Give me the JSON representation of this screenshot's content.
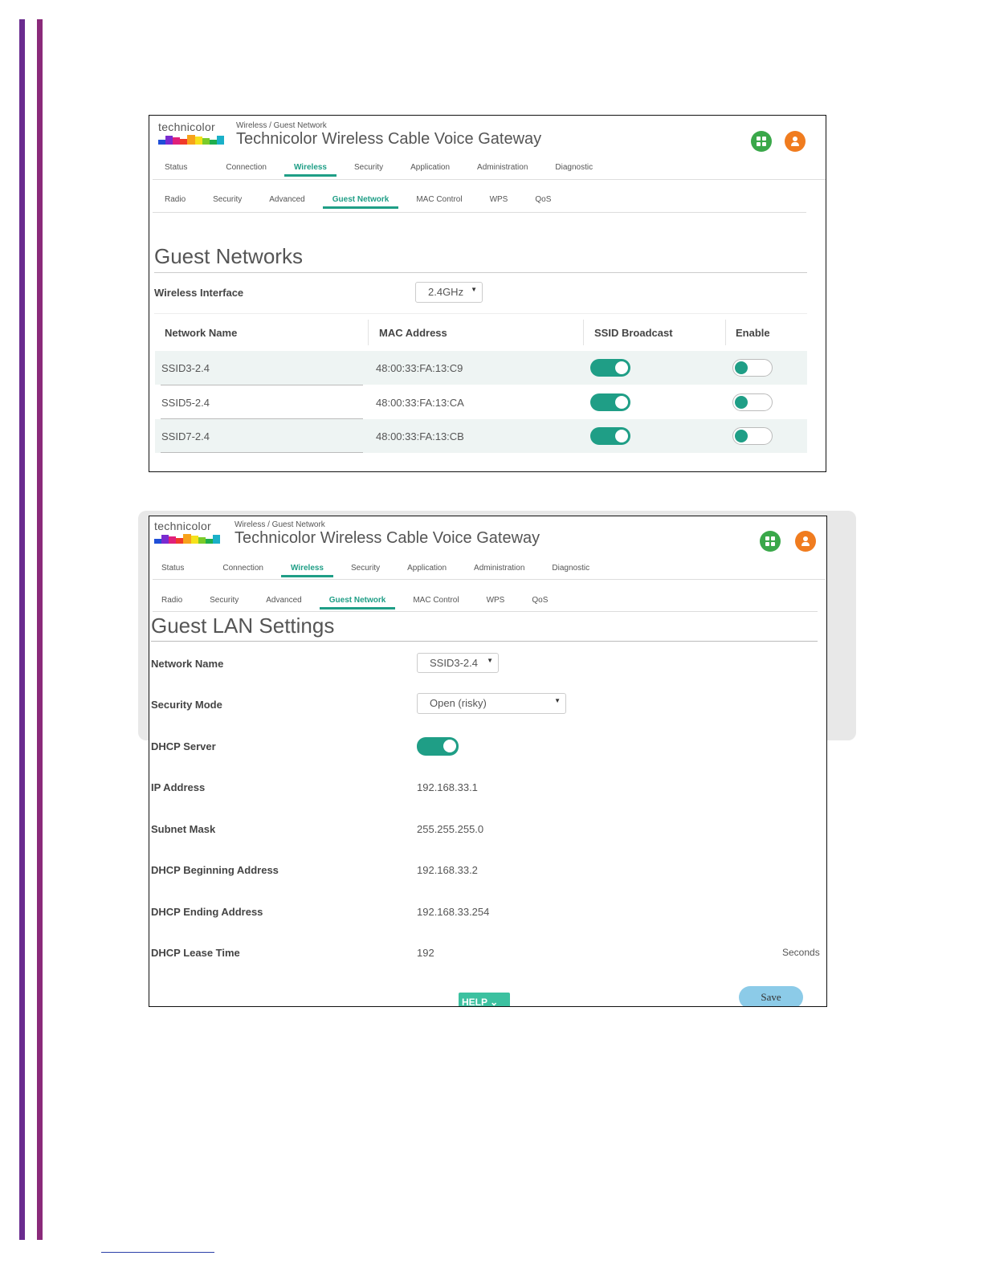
{
  "brand": {
    "logo_text": "technicolor",
    "strip_colors": [
      "#1f4fd8",
      "#7a2bd0",
      "#e0207a",
      "#f03a2a",
      "#f7a21b",
      "#f5e11b",
      "#7acb2a",
      "#1fae4c",
      "#1ab0c8"
    ]
  },
  "header": {
    "breadcrumb": "Wireless / Guest Network",
    "title": "Technicolor Wireless Cable Voice Gateway",
    "apps_icon": "grid-icon",
    "user_icon": "user-icon"
  },
  "main_tabs": [
    "Status",
    "Connection",
    "Wireless",
    "Security",
    "Application",
    "Administration",
    "Diagnostic"
  ],
  "main_tab_active": "Wireless",
  "sub_tabs": [
    "Radio",
    "Security",
    "Advanced",
    "Guest Network",
    "MAC Control",
    "WPS",
    "QoS"
  ],
  "sub_tab_active": "Guest Network",
  "guest_networks": {
    "title": "Guest Networks",
    "interface_label": "Wireless Interface",
    "interface_value": "2.4GHz",
    "columns": [
      "Network Name",
      "MAC Address",
      "SSID Broadcast",
      "Enable"
    ],
    "rows": [
      {
        "name": "SSID3-2.4",
        "mac": "48:00:33:FA:13:C9",
        "ssid_broadcast": true,
        "enable": false
      },
      {
        "name": "SSID5-2.4",
        "mac": "48:00:33:FA:13:CA",
        "ssid_broadcast": true,
        "enable": false
      },
      {
        "name": "SSID7-2.4",
        "mac": "48:00:33:FA:13:CB",
        "ssid_broadcast": true,
        "enable": false
      }
    ]
  },
  "guest_lan": {
    "title": "Guest LAN Settings",
    "network_name_label": "Network Name",
    "network_name_value": "SSID3-2.4",
    "security_mode_label": "Security Mode",
    "security_mode_value": "Open (risky)",
    "dhcp_server_label": "DHCP Server",
    "dhcp_server_on": true,
    "ip_address_label": "IP Address",
    "ip_address_value": "192.168.33.1",
    "subnet_mask_label": "Subnet Mask",
    "subnet_mask_value": "255.255.255.0",
    "dhcp_begin_label": "DHCP Beginning Address",
    "dhcp_begin_value": "192.168.33.2",
    "dhcp_end_label": "DHCP Ending Address",
    "dhcp_end_value": "192.168.33.254",
    "lease_label": "DHCP Lease Time",
    "lease_value": "192",
    "lease_unit": "Seconds",
    "help_label": "HELP",
    "save_label": "Save"
  }
}
